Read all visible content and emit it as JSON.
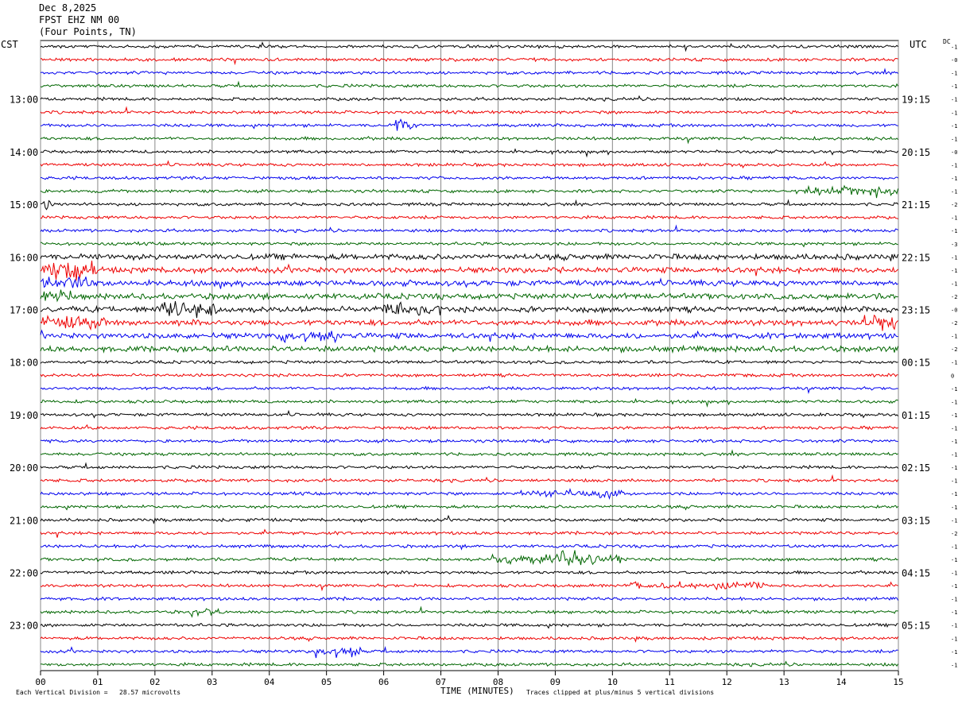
{
  "header": {
    "date": "Dec 8,2025",
    "station": "FPST EHZ NM 00",
    "location": "(Four Points, TN)"
  },
  "left_tz": "CST",
  "right_tz": "UTC",
  "dc_label": "DC",
  "footer": {
    "scale": "Each Vertical Division =   28.57 microvolts",
    "xaxis_title": "TIME (MINUTES)",
    "clip_note": "Traces clipped at plus/minus 5 vertical divisions"
  },
  "chart_data": {
    "type": "line",
    "x_ticks": [
      "00",
      "01",
      "02",
      "03",
      "04",
      "05",
      "06",
      "07",
      "08",
      "09",
      "10",
      "11",
      "12",
      "13",
      "14",
      "15"
    ],
    "xlim": [
      0,
      15
    ],
    "trace_count": 48,
    "trace_colors": [
      "#000000",
      "#ee0000",
      "#0000ee",
      "#006600"
    ],
    "left_hour_labels": [
      "13:00",
      "14:00",
      "15:00",
      "16:00",
      "17:00",
      "18:00",
      "19:00",
      "20:00",
      "21:00",
      "22:00",
      "23:00"
    ],
    "right_hour_labels": [
      "19:15",
      "20:15",
      "21:15",
      "22:15",
      "23:15",
      "00:15",
      "01:15",
      "02:15",
      "03:15",
      "04:15",
      "05:15"
    ],
    "dc_offsets": [
      "-1",
      "-0",
      "-1",
      "-1",
      "-1",
      "-1",
      "-1",
      "-1",
      "-0",
      "-1",
      "-1",
      "-1",
      "-2",
      "-1",
      "-1",
      "-3",
      "-1",
      "-1",
      "-1",
      "-2",
      "-0",
      "-2",
      "-1",
      "-2",
      "-1",
      "0",
      "-1",
      "-1",
      "-1",
      "-1",
      "-1",
      "-1",
      "-1",
      "-1",
      "-1",
      "-1",
      "-1",
      "-2",
      "-1",
      "-1",
      "-1",
      "-1",
      "-1",
      "-1",
      "-1",
      "-1",
      "-1",
      "-1"
    ],
    "grid": true
  }
}
